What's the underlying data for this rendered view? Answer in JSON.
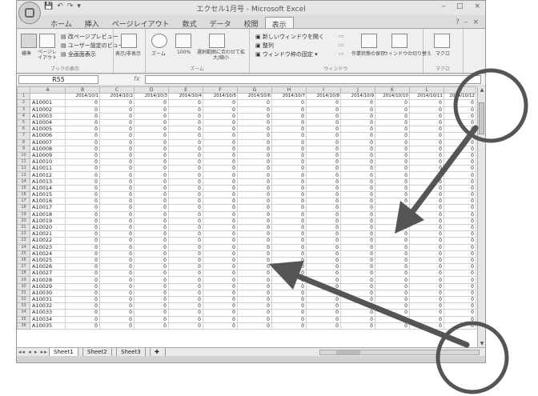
{
  "window": {
    "title": "エクセル1月号 - Microsoft Excel",
    "qat": [
      "💾",
      "↶",
      "↷",
      "▾"
    ],
    "controls": [
      "–",
      "□",
      "×"
    ]
  },
  "tabs": [
    "ホーム",
    "挿入",
    "ページレイアウト",
    "数式",
    "データ",
    "校閲",
    "表示"
  ],
  "active_tab": "表示",
  "ribbon": {
    "groups": [
      {
        "label": "ブックの表示",
        "buttons": [
          "標準",
          "ページレイアウト"
        ],
        "items": [
          "改ページプレビュー",
          "ユーザー設定のビュー",
          "全画面表示"
        ]
      },
      {
        "label": "",
        "buttons": [
          "表示/非表示"
        ]
      },
      {
        "label": "ズーム",
        "buttons": [
          "ズーム",
          "100%",
          "選択範囲に合わせて拡大/縮小"
        ]
      },
      {
        "label": "ウィンドウ",
        "items": [
          "新しいウィンドウを開く",
          "整列",
          "ウィンドウ枠の固定"
        ],
        "buttons": [
          "作業状態の保存",
          "ウィンドウの切り替え"
        ]
      },
      {
        "label": "マクロ",
        "buttons": [
          "マクロ"
        ]
      }
    ]
  },
  "formula_bar": {
    "name_box": "R55",
    "fx": "fx",
    "value": ""
  },
  "grid": {
    "columns": [
      "",
      "A",
      "B",
      "C",
      "D",
      "E",
      "F",
      "G",
      "H",
      "I",
      "J",
      "K",
      "L",
      "M"
    ],
    "header_row": [
      "",
      "2014/10/1",
      "2014/10/2",
      "2014/10/3",
      "2014/10/4",
      "2014/10/5",
      "2014/10/6",
      "2014/10/7",
      "2014/10/8",
      "2014/10/9",
      "2014/10/10",
      "2014/10/11",
      "2014/10/12"
    ],
    "row_ids": [
      "A10001",
      "A10002",
      "A10003",
      "A10004",
      "A10005",
      "A10006",
      "A10007",
      "A10008",
      "A10009",
      "A10010",
      "A10011",
      "A10012",
      "A10013",
      "A10014",
      "A10015",
      "A10016",
      "A10017",
      "A10018",
      "A10019",
      "A10020",
      "A10021",
      "A10022",
      "A10023",
      "A10024",
      "A10025",
      "A10026",
      "A10027",
      "A10028",
      "A10029",
      "A10030",
      "A10031",
      "A10032",
      "A10033",
      "A10034",
      "A10035"
    ],
    "cell_value": "0",
    "row_numbers_start": 1
  },
  "sheet_tabs": {
    "nav": "◂◂ ◂ ▸ ▸▸",
    "tabs": [
      "Sheet1",
      "Sheet2",
      "Sheet3"
    ],
    "active": "Sheet1",
    "insert_icon": "insert-sheet-icon"
  },
  "annotations": {
    "color": "#555555",
    "circles": [
      "top-right-corner-circle",
      "bottom-right-corner-circle"
    ],
    "arrows": [
      "arrow-to-grid-center-from-top-right",
      "arrow-to-grid-center-from-bottom-right"
    ]
  }
}
